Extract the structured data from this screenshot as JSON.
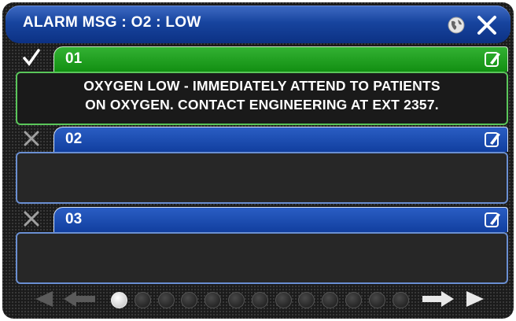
{
  "window": {
    "title": "ALARM MSG : O2 : LOW"
  },
  "header_icons": [
    "globe-icon",
    "close-icon"
  ],
  "slots": [
    {
      "number": "01",
      "state": "selected",
      "status_icon": "check-icon",
      "message_lines": [
        "OXYGEN LOW - IMMEDIATELY ATTEND TO PATIENTS",
        "ON OXYGEN. CONTACT ENGINEERING AT EXT 2357."
      ]
    },
    {
      "number": "02",
      "state": "unselected",
      "status_icon": "x-mark-icon",
      "message_lines": []
    },
    {
      "number": "03",
      "state": "unselected",
      "status_icon": "x-mark-icon",
      "message_lines": []
    }
  ],
  "pager": {
    "page_count": 13,
    "current_page": 1
  },
  "colors": {
    "title_bar": "#17449e",
    "selected_tab": "#1f9f1f",
    "unselected_tab": "#1a4bb0",
    "panel": "#272727"
  }
}
